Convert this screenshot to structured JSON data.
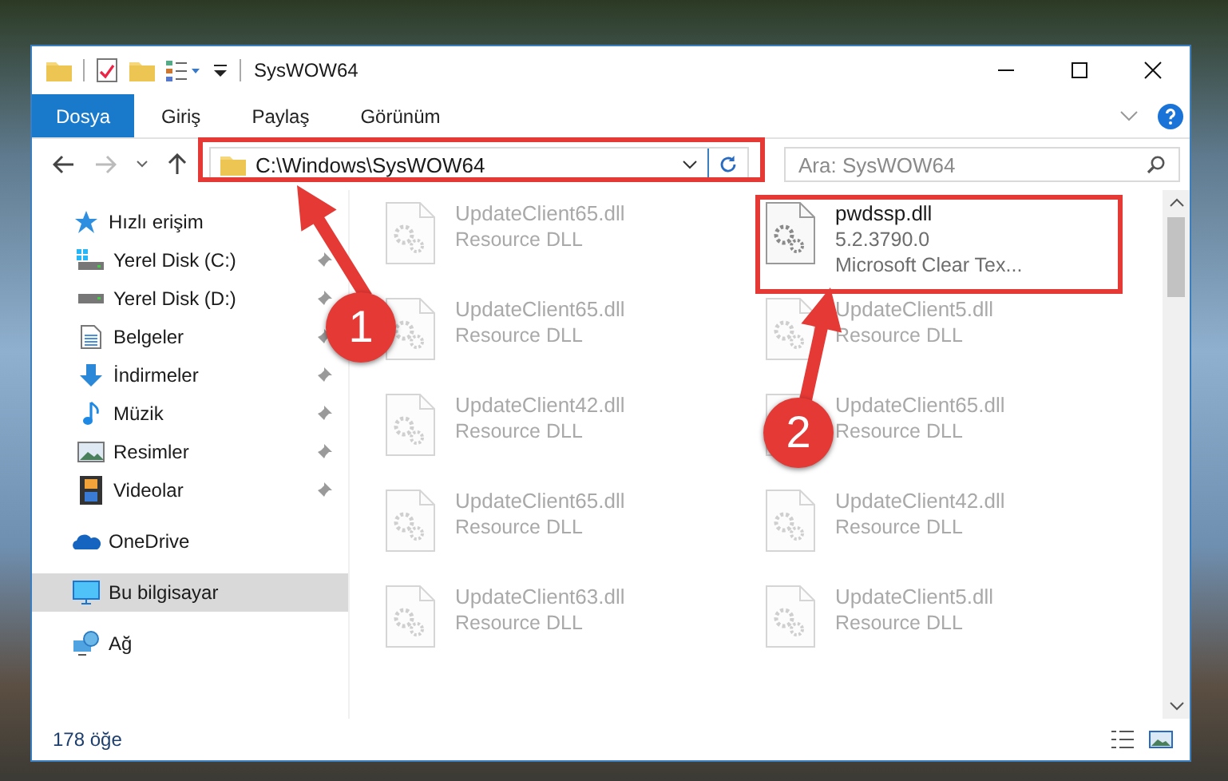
{
  "window": {
    "title": "SysWOW64"
  },
  "ribbon": {
    "tabs": [
      {
        "label": "Dosya",
        "selected": true
      },
      {
        "label": "Giriş",
        "selected": false
      },
      {
        "label": "Paylaş",
        "selected": false
      },
      {
        "label": "Görünüm",
        "selected": false
      }
    ]
  },
  "address": {
    "path": "C:\\Windows\\SysWOW64",
    "highlighted": true
  },
  "search": {
    "placeholder": "Ara: SysWOW64"
  },
  "sidebar": {
    "items": [
      {
        "label": "Hızlı erişim",
        "kind": "star",
        "selected": false,
        "children": [
          {
            "label": "Yerel Disk (C:)",
            "kind": "drive-c",
            "pinned": true
          },
          {
            "label": "Yerel Disk (D:)",
            "kind": "drive",
            "pinned": true
          },
          {
            "label": "Belgeler",
            "kind": "documents",
            "pinned": true
          },
          {
            "label": "İndirmeler",
            "kind": "downloads",
            "pinned": true
          },
          {
            "label": "Müzik",
            "kind": "music",
            "pinned": true
          },
          {
            "label": "Resimler",
            "kind": "pictures",
            "pinned": true
          },
          {
            "label": "Videolar",
            "kind": "videos",
            "pinned": true
          }
        ]
      },
      {
        "label": "OneDrive",
        "kind": "cloud",
        "selected": false
      },
      {
        "label": "Bu bilgisayar",
        "kind": "computer",
        "selected": true
      },
      {
        "label": "Ağ",
        "kind": "network",
        "selected": false
      }
    ]
  },
  "files": [
    {
      "name": "UpdateClient65.dll",
      "details": [
        "Resource DLL"
      ],
      "blurred": true,
      "highlighted": false
    },
    {
      "name": "pwdssp.dll",
      "details": [
        "5.2.3790.0",
        "Microsoft Clear Tex..."
      ],
      "blurred": false,
      "highlighted": true
    },
    {
      "name": "UpdateClient65.dll",
      "details": [
        "Resource DLL"
      ],
      "blurred": true,
      "highlighted": false
    },
    {
      "name": "UpdateClient5.dll",
      "details": [
        "Resource DLL"
      ],
      "blurred": true,
      "highlighted": false
    },
    {
      "name": "UpdateClient42.dll",
      "details": [
        "Resource DLL"
      ],
      "blurred": true,
      "highlighted": false
    },
    {
      "name": "UpdateClient65.dll",
      "details": [
        "Resource DLL"
      ],
      "blurred": true,
      "highlighted": false
    },
    {
      "name": "UpdateClient65.dll",
      "details": [
        "Resource DLL"
      ],
      "blurred": true,
      "highlighted": false
    },
    {
      "name": "UpdateClient42.dll",
      "details": [
        "Resource DLL"
      ],
      "blurred": true,
      "highlighted": false
    },
    {
      "name": "UpdateClient63.dll",
      "details": [
        "Resource DLL"
      ],
      "blurred": true,
      "highlighted": false
    },
    {
      "name": "UpdateClient5.dll",
      "details": [
        "Resource DLL"
      ],
      "blurred": true,
      "highlighted": false
    }
  ],
  "status_bar": {
    "count": "178 öğe"
  },
  "annotations": [
    {
      "number": "1"
    },
    {
      "number": "2"
    }
  ]
}
